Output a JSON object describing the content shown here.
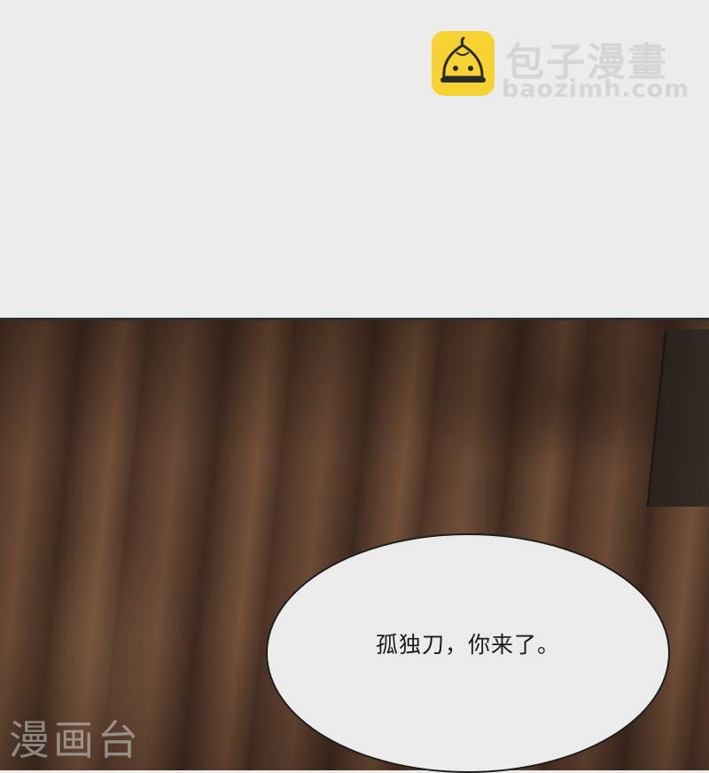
{
  "brand": {
    "name_cn": "包子漫畫",
    "url": "baozimh.com",
    "color": "#f7d233"
  },
  "bubble": {
    "text": "孤独刀，你来了。"
  },
  "watermark": {
    "text": "漫画台"
  }
}
